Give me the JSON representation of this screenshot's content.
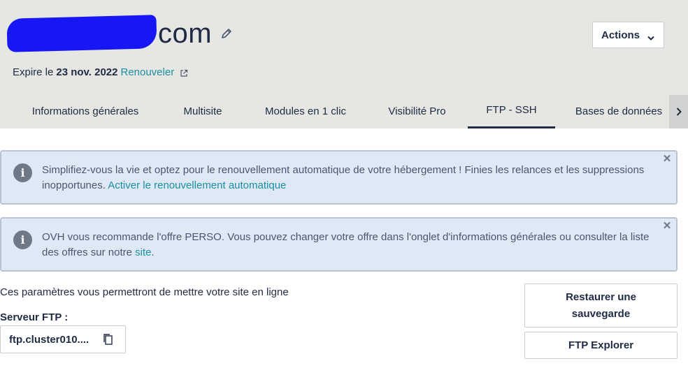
{
  "header": {
    "domain_suffix": "com",
    "actions_label": "Actions",
    "expire_prefix": "Expire le",
    "expire_date": "23 nov. 2022",
    "renew_label": "Renouveler"
  },
  "tabs": [
    {
      "label": "Informations générales"
    },
    {
      "label": "Multisite"
    },
    {
      "label": "Modules en 1 clic"
    },
    {
      "label": "Visibilité Pro"
    },
    {
      "label": "FTP - SSH"
    },
    {
      "label": "Bases de données"
    }
  ],
  "active_tab": "FTP - SSH",
  "banners": [
    {
      "text": "Simplifiez-vous la vie et optez pour le renouvellement automatique de votre hébergement ! Finies les relances et les suppressions inopportunes.",
      "link": "Activer le renouvellement automatique"
    },
    {
      "text": "OVH vous recommande l'offre PERSO. Vous pouvez changer votre offre dans l'onglet d'informations générales ou consulter la liste des offres sur notre",
      "link": "site",
      "suffix": "."
    }
  ],
  "ftp": {
    "intro": "Ces paramètres vous permettront de mettre votre site en ligne",
    "server_label": "Serveur FTP :",
    "server_value": "ftp.cluster010...."
  },
  "buttons": {
    "restore": "Restaurer une sauvegarde",
    "ftp_explorer": "FTP Explorer"
  },
  "colors": {
    "header_bg": "#e6e7e3",
    "banner_bg": "#dfe9f5",
    "link": "#1a8fa3",
    "redaction": "#1717f5",
    "text": "#1f2a44"
  }
}
